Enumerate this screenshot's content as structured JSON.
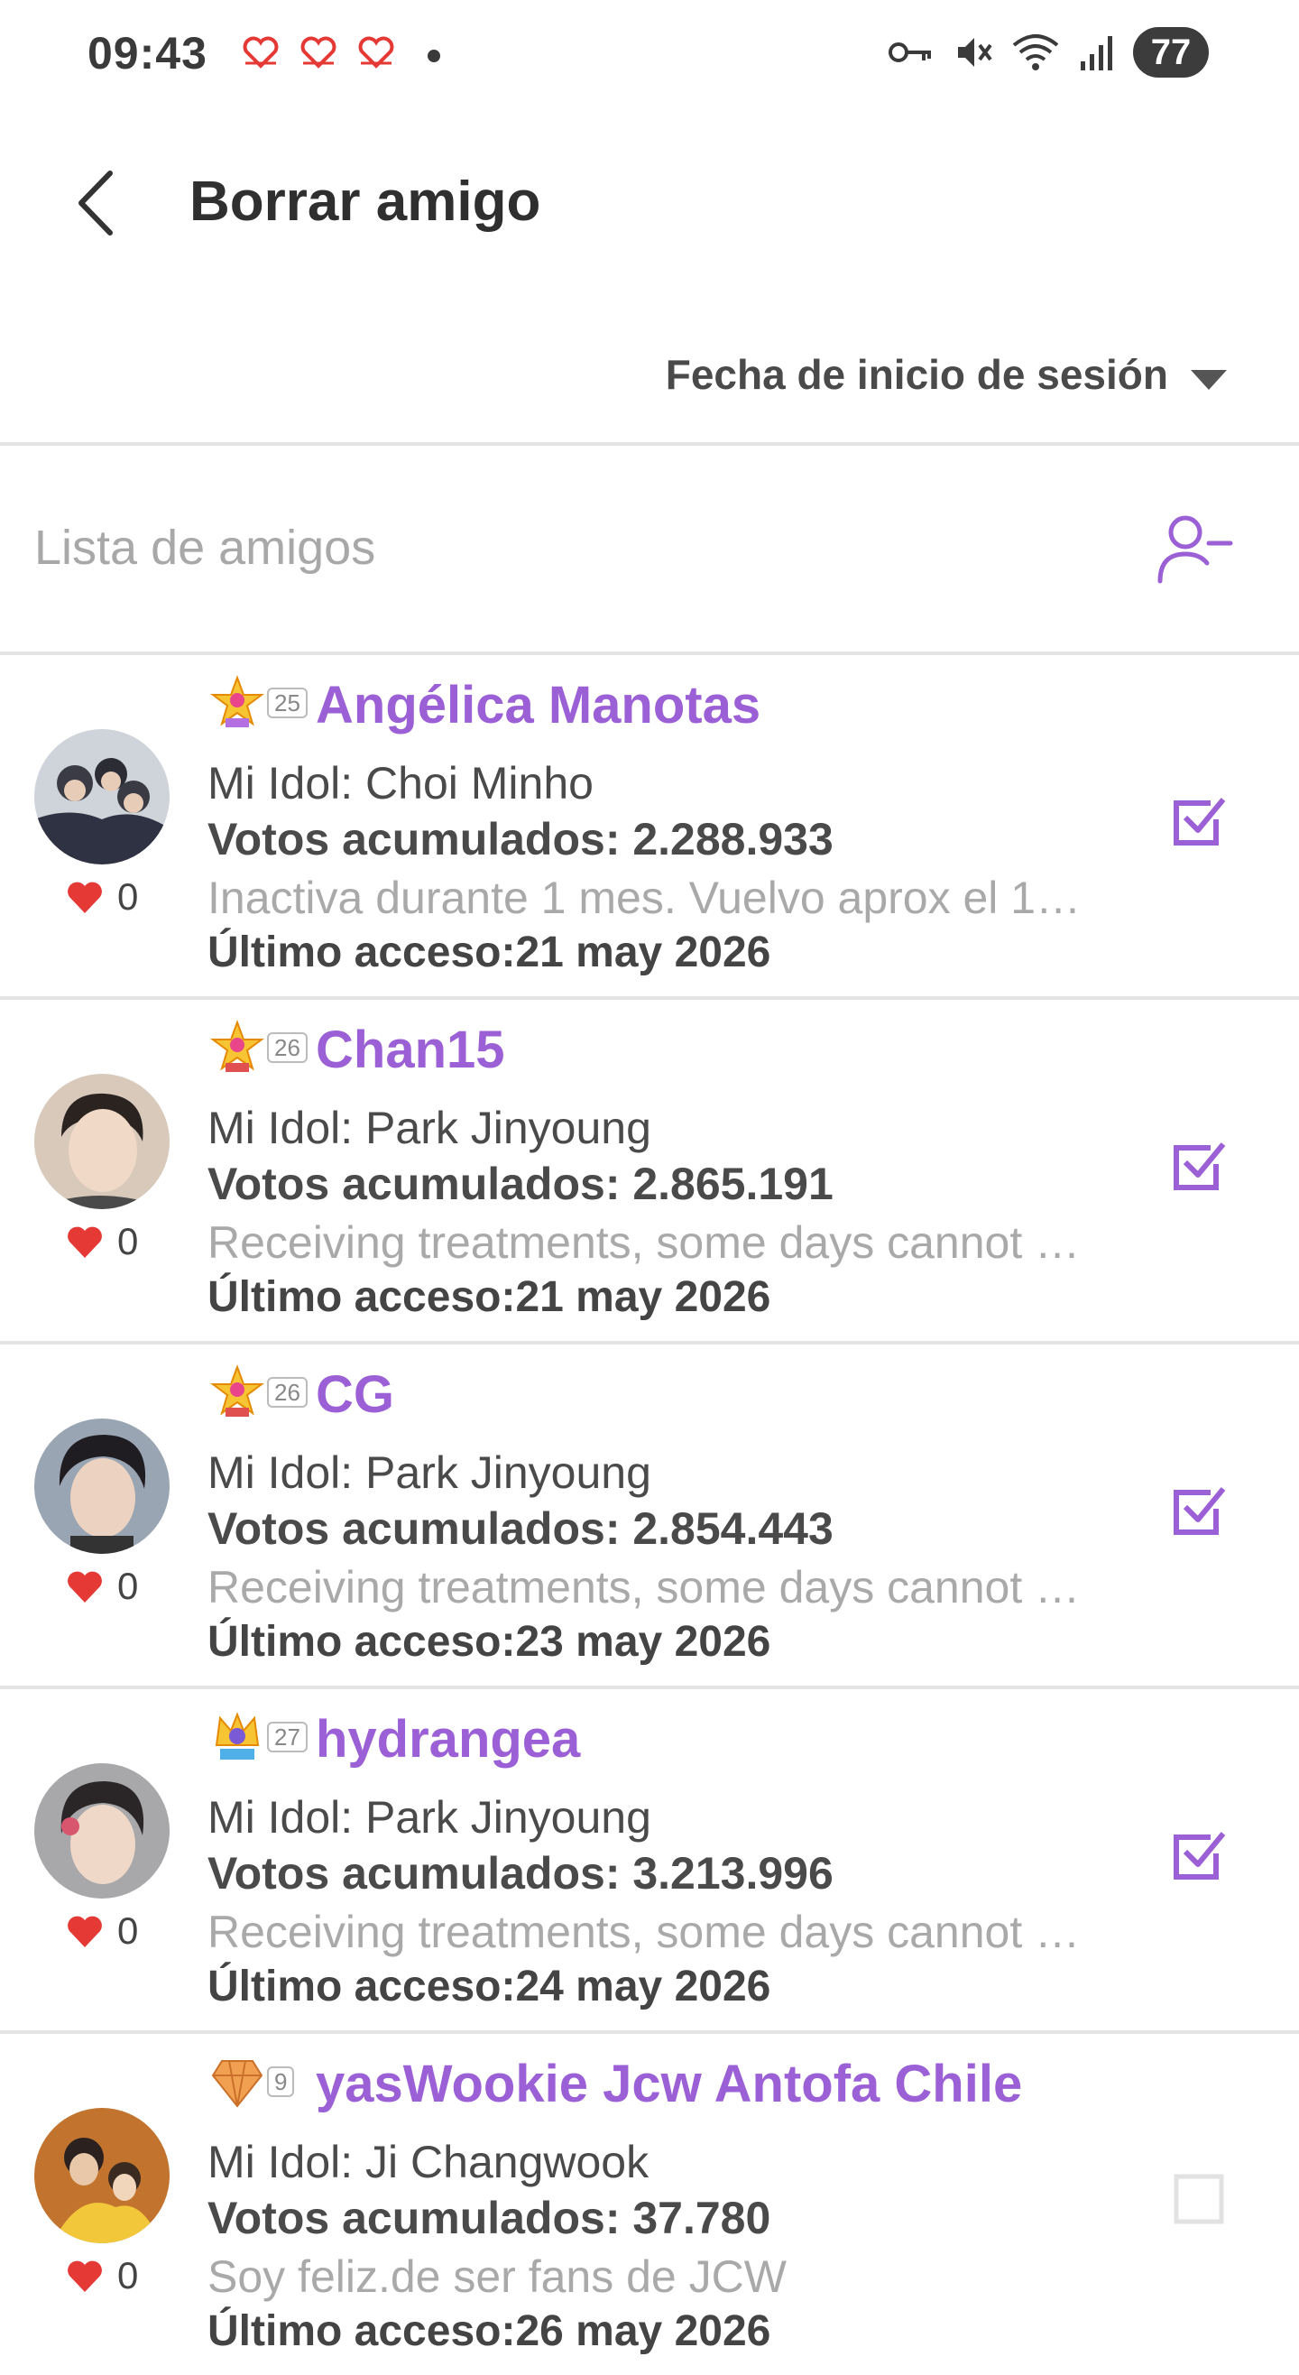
{
  "status_bar": {
    "time": "09:43",
    "battery": "77"
  },
  "header": {
    "title": "Borrar amigo"
  },
  "sort": {
    "label": "Fecha de inicio de sesión"
  },
  "list": {
    "title": "Lista de amigos"
  },
  "colors": {
    "accent": "#9b5fd6",
    "heart": "#e53935"
  },
  "friends": [
    {
      "level": "25",
      "name": "Angélica Manotas",
      "idol": "Mi Idol: Choi Minho",
      "votes": "Votos acumulados: 2.288.933",
      "status": "Inactiva durante 1 mes. Vuelvo aprox el 1…",
      "last_access": "Último acceso:21 may 2026",
      "likes": "0",
      "checked": true,
      "badge_icon": "star-badge-icon"
    },
    {
      "level": "26",
      "name": "Chan15",
      "idol": "Mi Idol: Park Jinyoung",
      "votes": "Votos acumulados: 2.865.191",
      "status": "Receiving treatments, some days cannot …",
      "last_access": "Último acceso:21 may 2026",
      "likes": "0",
      "checked": true,
      "badge_icon": "star-badge-icon"
    },
    {
      "level": "26",
      "name": "CG",
      "idol": "Mi Idol: Park Jinyoung",
      "votes": "Votos acumulados: 2.854.443",
      "status": "Receiving treatments, some days cannot …",
      "last_access": "Último acceso:23 may 2026",
      "likes": "0",
      "checked": true,
      "badge_icon": "star-badge-icon"
    },
    {
      "level": "27",
      "name": "hydrangea",
      "idol": "Mi Idol: Park Jinyoung",
      "votes": "Votos acumulados: 3.213.996",
      "status": "Receiving treatments, some days cannot …",
      "last_access": "Último acceso:24 may 2026",
      "likes": "0",
      "checked": true,
      "badge_icon": "crown-badge-icon"
    },
    {
      "level": "9",
      "name": "yasWookie Jcw Antofa Chile",
      "idol": "Mi Idol: Ji Changwook",
      "votes": "Votos acumulados: 37.780",
      "status": "Soy feliz.de ser fans de JCW",
      "last_access": "Último acceso:26 may 2026",
      "likes": "0",
      "checked": false,
      "badge_icon": "gem-badge-icon"
    }
  ]
}
